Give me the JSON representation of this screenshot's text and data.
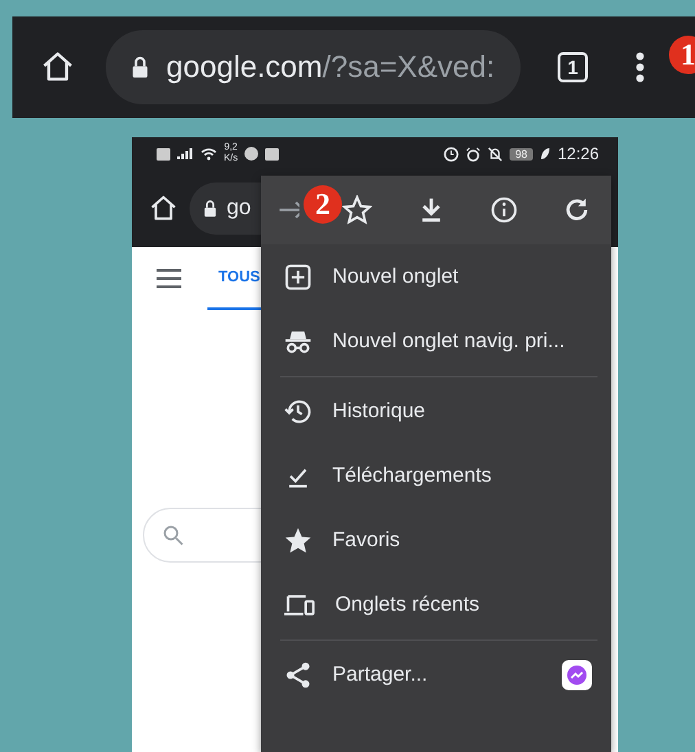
{
  "browser_toolbar": {
    "url_host": "google.com",
    "url_path": "/?sa=X&ved:",
    "tab_count": "1"
  },
  "callouts": [
    {
      "label": "1"
    },
    {
      "label": "2"
    }
  ],
  "phone": {
    "status_bar": {
      "speed_value": "9,2",
      "speed_unit": "K/s",
      "battery": "98",
      "time": "12:26"
    },
    "address_bar": {
      "url": "go"
    },
    "page": {
      "tabs": [
        {
          "label": "TOUS",
          "selected": true
        }
      ]
    },
    "menu": {
      "groups": [
        [
          {
            "label": "Nouvel onglet"
          },
          {
            "label": "Nouvel onglet navig. pri..."
          }
        ],
        [
          {
            "label": "Historique"
          },
          {
            "label": "Téléchargements"
          },
          {
            "label": "Favoris"
          },
          {
            "label": "Onglets récents"
          }
        ],
        [
          {
            "label": "Partager...",
            "app_badge": true
          }
        ]
      ]
    }
  }
}
